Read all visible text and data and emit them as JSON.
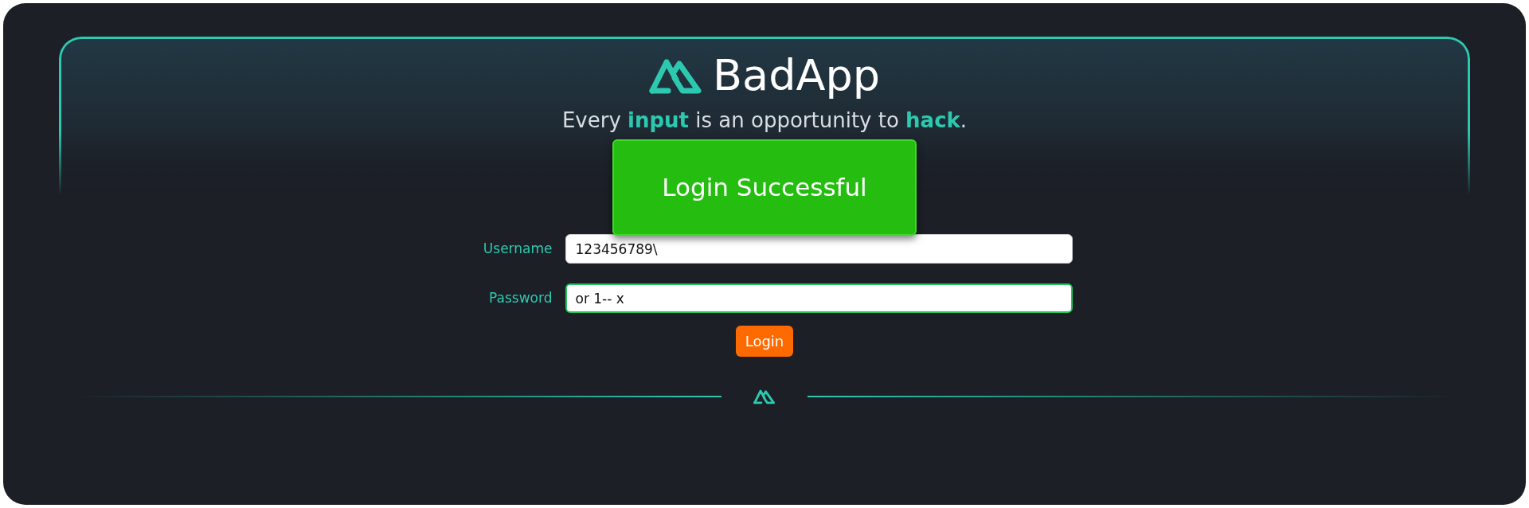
{
  "brand": {
    "name": "BadApp"
  },
  "tagline": "Every **input** is an opportunity to **hack**.",
  "alert": {
    "text": "Login Successful"
  },
  "fields": [
    {
      "label": "Username",
      "value": "123456789\\",
      "focused": false
    },
    {
      "label": "Password",
      "value": "or 1-- x",
      "focused": true
    }
  ],
  "login_button": "Login"
}
